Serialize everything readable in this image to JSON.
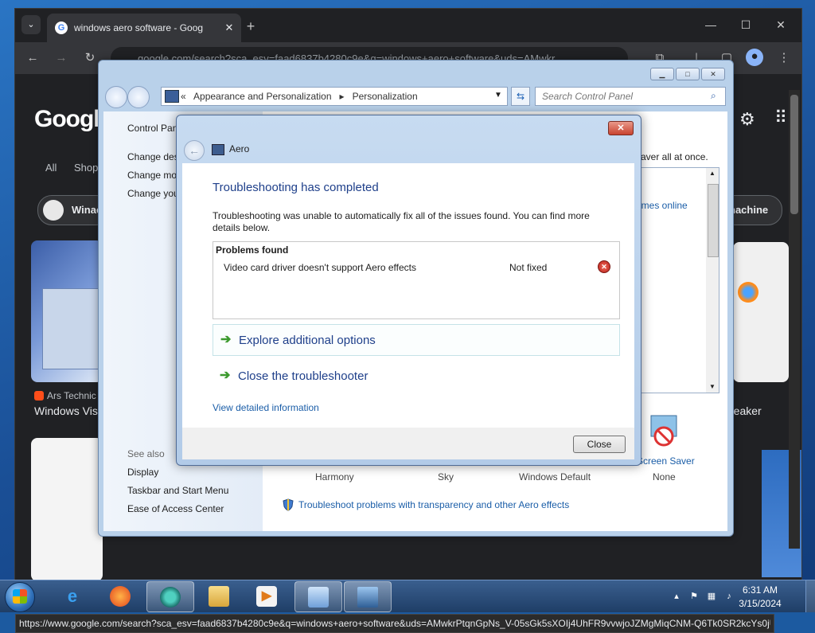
{
  "browser": {
    "tab_title": "windows aero software - Goog",
    "address": "google.com/search?sca_esv=faad6837b4280c9e&q=windows+aero+software&uds=AMwkr",
    "status_url": "https://www.google.com/search?sca_esv=faad6837b4280c9e&q=windows+aero+software&uds=AMwkrPtqnGpNs_V-05sGk5sXOIj4UhFR9vvwjoJZMgMiqCNM-Q6Tk0SR2kcYs0jU..."
  },
  "google": {
    "logo": "Googl",
    "tabs": [
      "All",
      "Shop"
    ],
    "chip_left": "Winac",
    "chip_right": "nachine",
    "source": "Ars Technic",
    "result_left_title": "Windows Vis",
    "result_right_title": "reaker"
  },
  "control_panel": {
    "breadcrumb_sep": "«",
    "breadcrumb_1": "Appearance and Personalization",
    "breadcrumb_arrow": "▸",
    "breadcrumb_2": "Personalization",
    "search_placeholder": "Search Control Panel",
    "sidebar_home": "Control Pan",
    "sidebar_links": [
      "Change des",
      "Change mo",
      "Change you"
    ],
    "see_also": "See also",
    "see_also_links": [
      "Display",
      "Taskbar and Start Menu",
      "Ease of Access Center"
    ],
    "main_partial": "aver all at once.",
    "themes_online": "emes online",
    "screen_saver": "Screen Saver",
    "theme_labels": [
      "Harmony",
      "Sky",
      "Windows Default",
      "None"
    ],
    "troubleshoot_link": "Troubleshoot problems with transparency and other Aero effects"
  },
  "dialog": {
    "app_title": "Aero",
    "heading": "Troubleshooting has completed",
    "description": "Troubleshooting was unable to automatically fix all of the issues found. You can find more details below.",
    "problems_title": "Problems found",
    "problem": "Video card driver doesn't support Aero effects",
    "problem_status": "Not fixed",
    "option_explore": "Explore additional options",
    "option_close": "Close the troubleshooter",
    "detail_link": "View detailed information",
    "close_button": "Close"
  },
  "taskbar": {
    "time": "6:31 AM",
    "date": "3/15/2024"
  },
  "colors": {
    "heading_blue": "#1e3f8a",
    "link_blue": "#1b5ea8",
    "error_red": "#b8201a",
    "arrow_green": "#3c9a2e"
  }
}
